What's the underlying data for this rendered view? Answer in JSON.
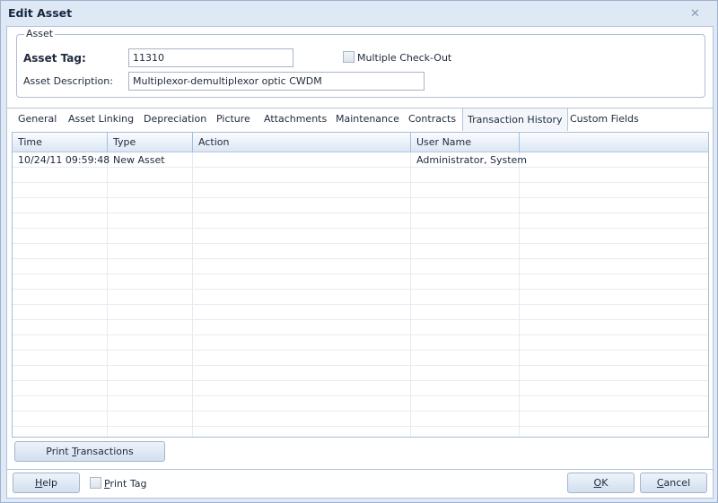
{
  "window": {
    "title": "Edit Asset",
    "close_icon": "close-icon"
  },
  "asset": {
    "group_label": "Asset",
    "tag_label": "Asset Tag:",
    "tag_value": "11310",
    "multi_checkout_label": "Multiple Check-Out",
    "multi_checkout_checked": false,
    "description_label": "Asset Description:",
    "description_value": "Multiplexor-demultiplexor optic CWDM"
  },
  "tabs": [
    {
      "label": "General"
    },
    {
      "label": "Asset Linking"
    },
    {
      "label": "Depreciation"
    },
    {
      "label": "Picture"
    },
    {
      "label": "Attachments"
    },
    {
      "label": "Maintenance"
    },
    {
      "label": "Contracts"
    },
    {
      "label": "Transaction History",
      "active": true
    },
    {
      "label": "Custom Fields"
    }
  ],
  "grid": {
    "columns": [
      "Time",
      "Type",
      "Action",
      "User Name",
      ""
    ],
    "rows": [
      [
        "10/24/11 09:59:48",
        "New Asset",
        "",
        "Administrator, System",
        ""
      ]
    ]
  },
  "buttons": {
    "print_transactions": {
      "pre": "Print ",
      "key": "T",
      "post": "ransactions"
    },
    "help": {
      "pre": "",
      "key": "H",
      "post": "elp"
    },
    "print_tag": {
      "pre": "",
      "key": "P",
      "post": "rint Tag",
      "checked": false
    },
    "ok": {
      "pre": "",
      "key": "O",
      "post": "K"
    },
    "cancel": {
      "pre": "",
      "key": "C",
      "post": "ancel"
    }
  }
}
